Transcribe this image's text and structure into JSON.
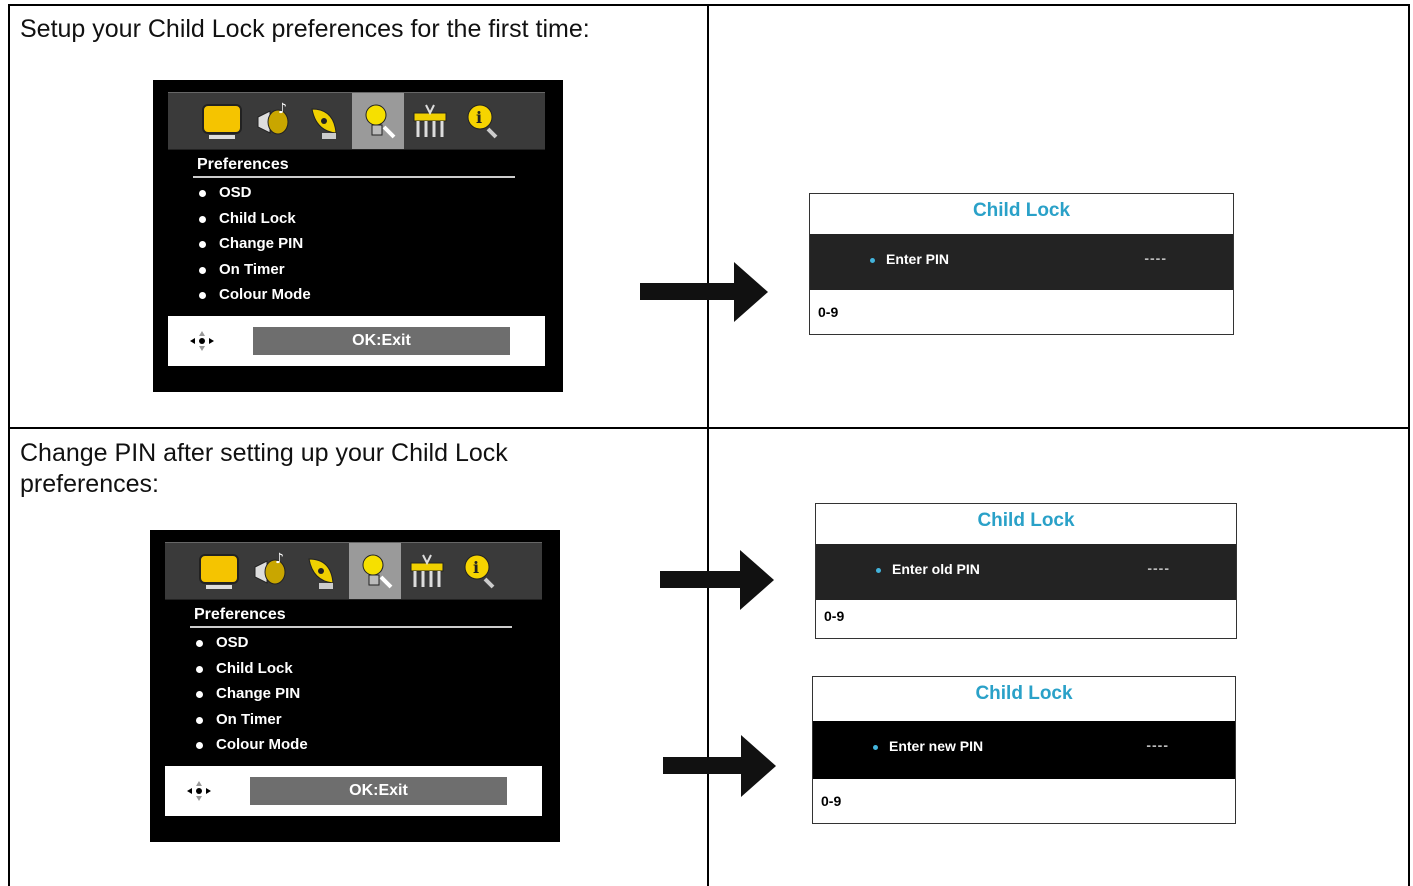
{
  "section_setup": {
    "caption": "Setup your Child Lock preferences for the first time:"
  },
  "section_change": {
    "caption_line1": "Change PIN after setting up your Child Lock",
    "caption_line2": "preferences:"
  },
  "osd_menu": {
    "tab_icons": [
      "tv-picture-icon",
      "sound-speaker-icon",
      "satellite-dish-icon",
      "bulb-preferences-icon",
      "antenna-tools-icon",
      "info-bulb-icon"
    ],
    "selected_tab_index": 3,
    "heading": "Preferences",
    "items": [
      "OSD",
      "Child Lock",
      "Change PIN",
      "On Timer",
      "Colour Mode"
    ],
    "nav_icon": "navigation-arrows-icon",
    "exit_label": "OK:Exit"
  },
  "dialog_enter_pin": {
    "title": "Child Lock",
    "label": "Enter PIN",
    "value": "----",
    "range": "0-9"
  },
  "dialog_old_pin": {
    "title": "Child Lock",
    "label": "Enter old PIN",
    "value": "----",
    "range": "0-9"
  },
  "dialog_new_pin": {
    "title": "Child Lock",
    "label": "Enter new PIN",
    "value": "----",
    "range": "0-9"
  },
  "colors": {
    "title_accent": "#2aa1c8",
    "selected_tab": "#9a9a9a",
    "exit_button": "#6e6e6e"
  }
}
